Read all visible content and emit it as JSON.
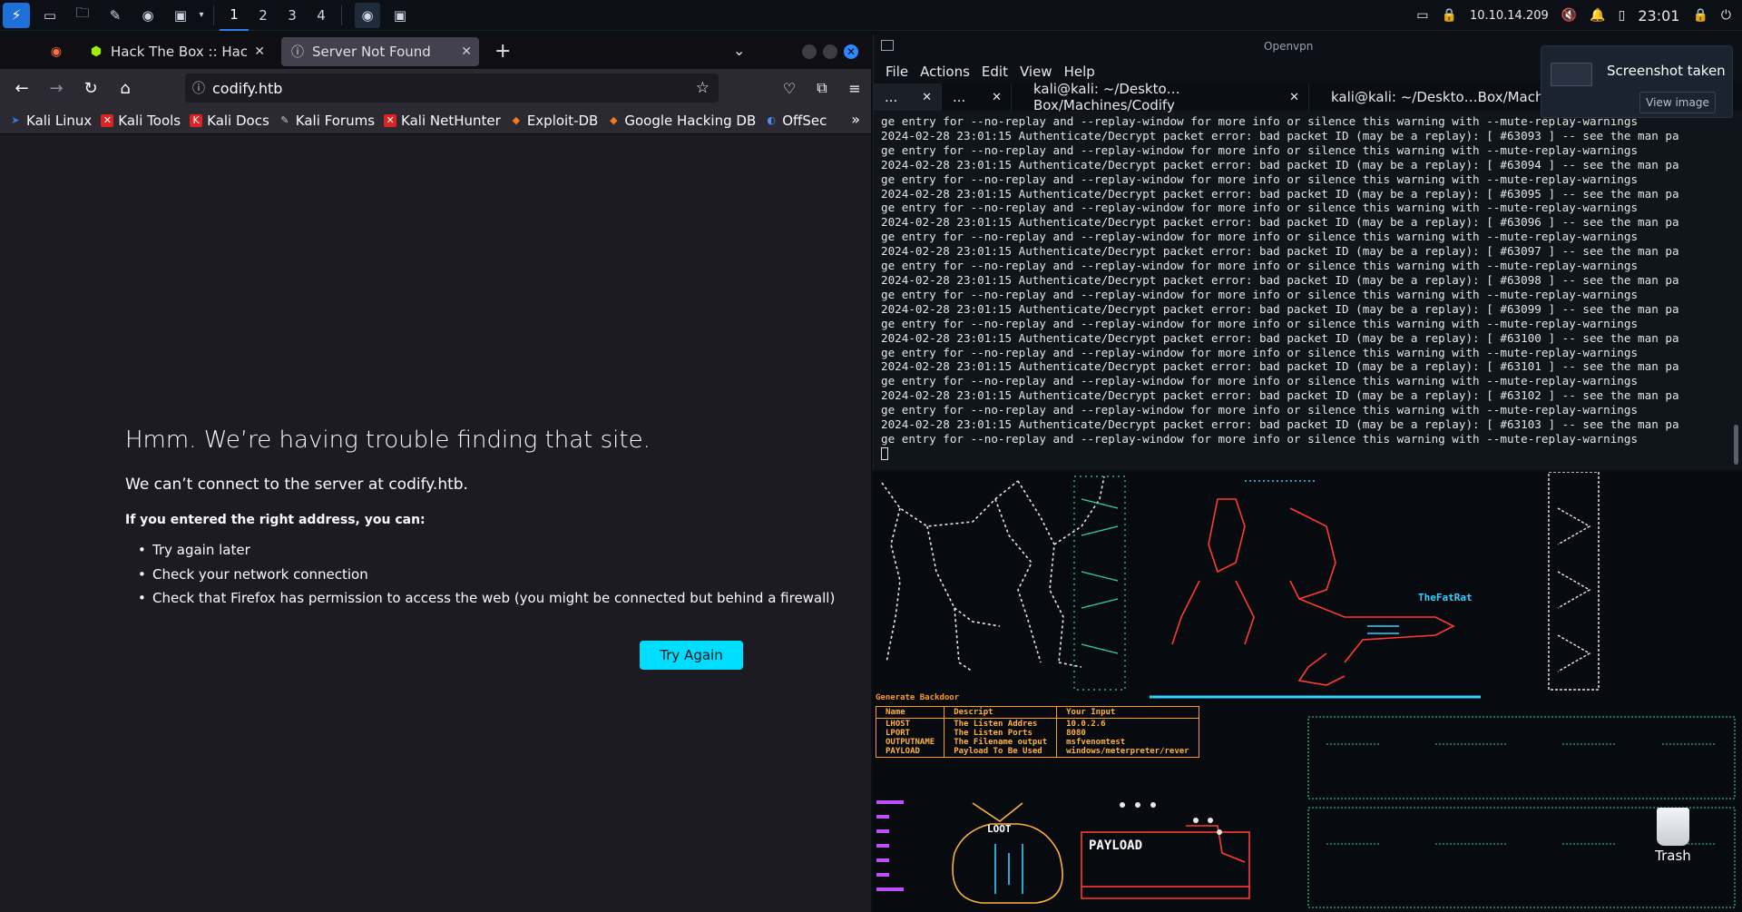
{
  "panel": {
    "workspaces": [
      "1",
      "2",
      "3",
      "4"
    ],
    "ip": "10.10.14.209",
    "time": "23:01"
  },
  "firefox": {
    "tabs": [
      {
        "label": "Hack The Box :: Hack The B"
      },
      {
        "label": "Server Not Found"
      }
    ],
    "url": "codify.htb",
    "bookmarks": [
      "Kali Linux",
      "Kali Tools",
      "Kali Docs",
      "Kali Forums",
      "Kali NetHunter",
      "Exploit-DB",
      "Google Hacking DB",
      "OffSec"
    ],
    "error": {
      "title": "Hmm. We’re having trouble finding that site.",
      "description": "We can’t connect to the server at codify.htb.",
      "subheading": "If you entered the right address, you can:",
      "tips": [
        "Try again later",
        "Check your network connection",
        "Check that Firefox has permission to access the web (you might be connected but behind a firewall)"
      ],
      "button": "Try Again"
    }
  },
  "terminal": {
    "window_title": "Openvpn",
    "menu": [
      "File",
      "Actions",
      "Edit",
      "View",
      "Help"
    ],
    "tabs": [
      {
        "label": "..."
      },
      {
        "label": "..."
      },
      {
        "label": "kali@kali: ~/Deskto…Box/Machines/Codify"
      },
      {
        "label": "kali@kali: ~/Deskto…Box/Machines/Codify"
      }
    ],
    "first_line": "ge entry for --no-replay and --replay-window for more info or silence this warning with --mute-replay-warnings",
    "log_prefix": "2024-02-28 23:01:15 Authenticate/Decrypt packet error: bad packet ID (may be a replay): [ ",
    "log_suffix": " ] -- see the man pa",
    "cont_line": "ge entry for --no-replay and --replay-window for more info or silence this warning with --mute-replay-warnings",
    "packet_ids": [
      "#63093",
      "#63094",
      "#63095",
      "#63096",
      "#63097",
      "#63098",
      "#63099",
      "#63100",
      "#63101",
      "#63102",
      "#63103"
    ]
  },
  "notification": {
    "title": "Screenshot taken",
    "button": "View image"
  },
  "desktop": {
    "fatrat_label": "TheFatRat",
    "generate_header": "Generate Backdoor",
    "generate_columns": [
      "Name",
      "Descript",
      "Your Input"
    ],
    "generate_rows": [
      [
        "LHOST",
        "The Listen Addres",
        "10.0.2.6"
      ],
      [
        "LPORT",
        "The Listen Ports",
        "8080"
      ],
      [
        "OUTPUTNAME",
        "The Filename output",
        "msfvenomtest"
      ],
      [
        "PAYLOAD",
        "Payload To Be Used",
        "windows/meterpreter/rever"
      ]
    ],
    "loot_label": "LOOT",
    "payload_label": "PAYLOAD",
    "trash_label": "Trash"
  }
}
